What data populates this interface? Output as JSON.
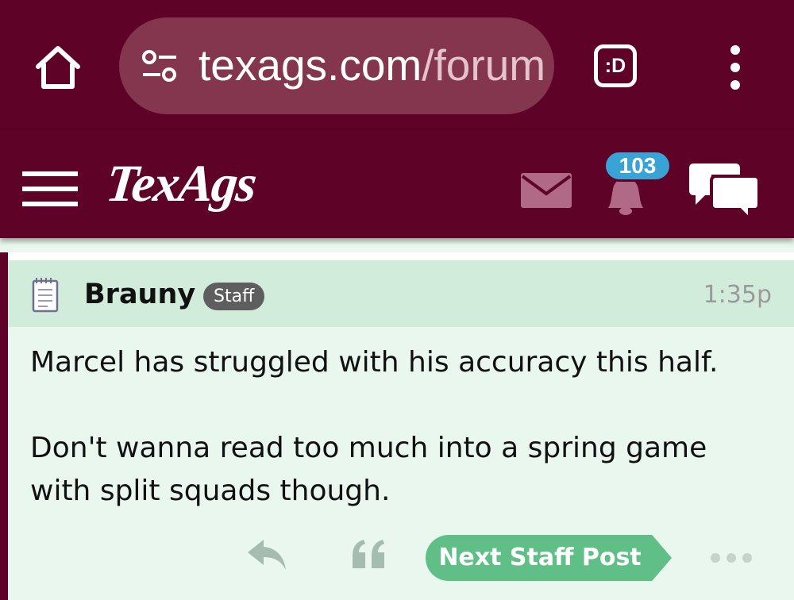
{
  "browser": {
    "url_host": "texags.com",
    "url_path": "/forum",
    "tabs_label": ":D",
    "icons": {
      "home": "home-icon",
      "site_settings": "tune-icon",
      "menu": "more-vertical-icon"
    }
  },
  "site": {
    "logo": "TexAgs",
    "notification_count": "103",
    "icons": {
      "menu": "hamburger-icon",
      "messages": "mail-icon",
      "notifications": "bell-icon",
      "chat": "chat-bubbles-icon"
    }
  },
  "post": {
    "author": "Brauny",
    "badge": "Staff",
    "time": "1:35p",
    "paragraphs": [
      "Marcel has struggled with his accuracy this half.",
      "Don't wanna read too much into a spring game with split squads though."
    ],
    "actions": {
      "reply_icon": "reply-icon",
      "quote_icon": "quote-icon",
      "next_staff_label": "Next Staff Post",
      "more_icon": "more-horizontal-icon"
    }
  },
  "colors": {
    "maroon": "#5e0228",
    "url_pill": "#85364f",
    "post_bg": "#e9f7ee",
    "post_header_bg": "#d1ecdb",
    "accent_green": "#5fbf86",
    "badge_blue": "#3aa3d6"
  }
}
